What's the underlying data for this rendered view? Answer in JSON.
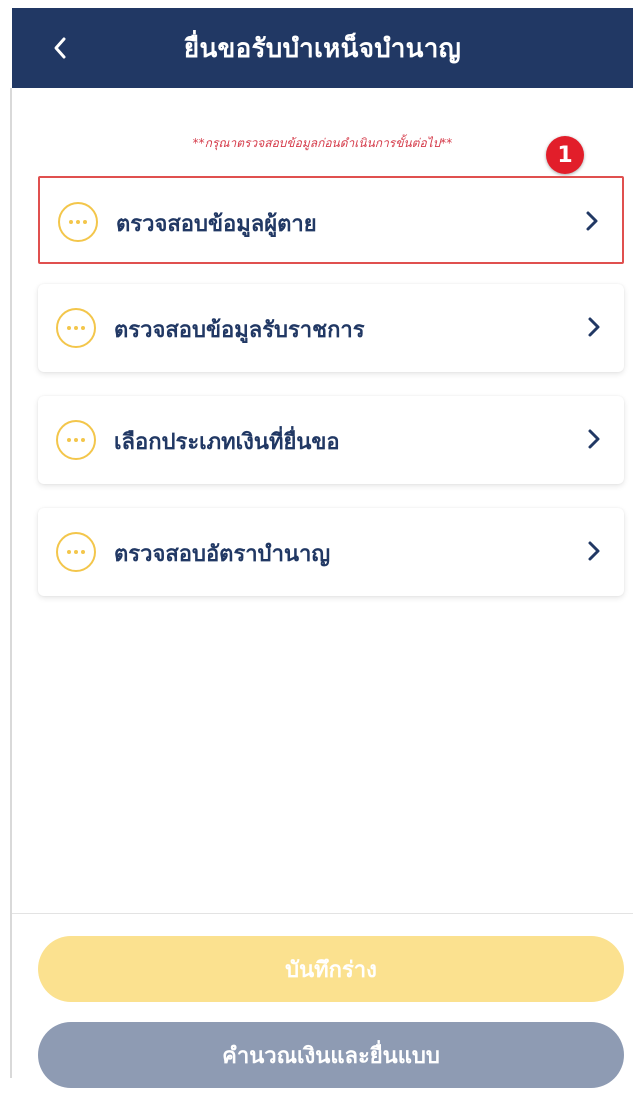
{
  "header": {
    "title": "ยื่นขอรับบำเหน็จบำนาญ"
  },
  "notice": "**กรุณาตรวจสอบข้อมูลก่อนดำเนินการขั้นต่อไป**",
  "step_marker": "1",
  "menu": {
    "items": [
      {
        "label": "ตรวจสอบข้อมูลผู้ตาย",
        "icon": "more-dots-icon"
      },
      {
        "label": "ตรวจสอบข้อมูลรับราชการ",
        "icon": "more-dots-icon"
      },
      {
        "label": "เลือกประเภทเงินที่ยื่นขอ",
        "icon": "more-dots-icon"
      },
      {
        "label": "ตรวจสอบอัตราบำนาญ",
        "icon": "more-dots-icon"
      }
    ]
  },
  "buttons": {
    "draft_label": "บันทึกร่าง",
    "submit_label": "คำนวณเงินและยื่นแบบ"
  },
  "colors": {
    "header_bg": "#213864",
    "icon_yellow": "#f3c64b",
    "draft_button": "#fbe18f",
    "submit_button": "#8e9bb3",
    "highlight_border": "#e0504f",
    "marker_red": "#e21e2a"
  }
}
